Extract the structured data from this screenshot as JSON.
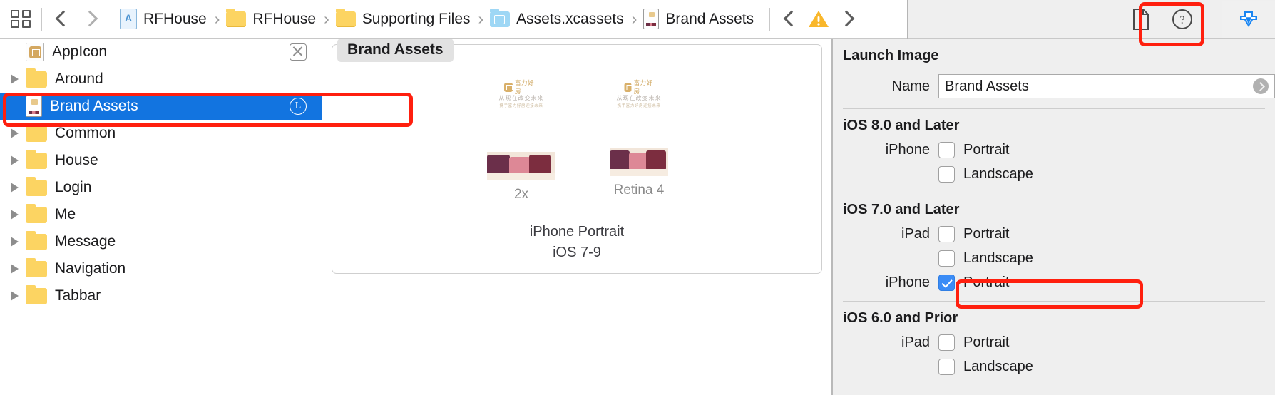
{
  "toolbar": {
    "grid_icon": "grid-icon",
    "back_label": "back",
    "forward_label": "forward",
    "breadcrumb": [
      {
        "label": "RFHouse",
        "icon": "app-project-icon"
      },
      {
        "label": "RFHouse",
        "icon": "folder-icon"
      },
      {
        "label": "Supporting Files",
        "icon": "folder-icon"
      },
      {
        "label": "Assets.xcassets",
        "icon": "xcassets-icon"
      },
      {
        "label": "Brand Assets",
        "icon": "launch-image-icon"
      }
    ],
    "separator": "›",
    "issue_nav_back": "‹",
    "issue_nav_forward": "›",
    "warning_icon": "warning-triangle-icon",
    "document_icon": "file-inspector-icon",
    "help_icon": "quick-help-icon",
    "inspector_toggle_icon": "hide-inspector-icon"
  },
  "sidebar": {
    "items": [
      {
        "label": "AppIcon",
        "icon": "appicon-asset-icon",
        "disclosure": "none",
        "badge": "unassigned-x-badge",
        "selected": false
      },
      {
        "label": "Around",
        "icon": "folder-icon",
        "disclosure": "closed",
        "badge": "",
        "selected": false
      },
      {
        "label": "Brand Assets",
        "icon": "launch-image-icon",
        "disclosure": "none",
        "badge": "L",
        "selected": true
      },
      {
        "label": "Common",
        "icon": "folder-icon",
        "disclosure": "closed",
        "badge": "",
        "selected": false
      },
      {
        "label": "House",
        "icon": "folder-icon",
        "disclosure": "closed",
        "badge": "",
        "selected": false
      },
      {
        "label": "Login",
        "icon": "folder-icon",
        "disclosure": "closed",
        "badge": "",
        "selected": false
      },
      {
        "label": "Me",
        "icon": "folder-icon",
        "disclosure": "closed",
        "badge": "",
        "selected": false
      },
      {
        "label": "Message",
        "icon": "folder-icon",
        "disclosure": "closed",
        "badge": "",
        "selected": false
      },
      {
        "label": "Navigation",
        "icon": "folder-icon",
        "disclosure": "closed",
        "badge": "",
        "selected": false
      },
      {
        "label": "Tabbar",
        "icon": "folder-icon",
        "disclosure": "closed",
        "badge": "",
        "selected": false
      }
    ]
  },
  "editor": {
    "card_title": "Brand Assets",
    "slots": [
      {
        "label": "2x",
        "logo_text": "富力好房",
        "headline": "从现在改变未来",
        "subline": "携手富力好房迎接未来"
      },
      {
        "label": "Retina 4",
        "logo_text": "富力好房",
        "headline": "从现在改变未来",
        "subline": "携手富力好房迎接未来"
      }
    ],
    "caption_line1": "iPhone Portrait",
    "caption_line2": "iOS 7-9"
  },
  "inspector": {
    "title": "Launch Image",
    "name_label": "Name",
    "name_value": "Brand Assets",
    "groups": [
      {
        "title": "iOS 8.0 and Later",
        "rows": [
          {
            "device": "iPhone",
            "orientation": "Portrait",
            "checked": false
          },
          {
            "device": "",
            "orientation": "Landscape",
            "checked": false
          }
        ]
      },
      {
        "title": "iOS 7.0 and Later",
        "rows": [
          {
            "device": "iPad",
            "orientation": "Portrait",
            "checked": false
          },
          {
            "device": "",
            "orientation": "Landscape",
            "checked": false
          },
          {
            "device": "iPhone",
            "orientation": "Portrait",
            "checked": true
          }
        ]
      },
      {
        "title": "iOS 6.0 and Prior",
        "rows": [
          {
            "device": "iPad",
            "orientation": "Portrait",
            "checked": false
          },
          {
            "device": "",
            "orientation": "Landscape",
            "checked": false
          }
        ]
      }
    ]
  },
  "annotations": {
    "color": "#ff1f0e",
    "boxes": [
      "sidebar-brand-assets-row",
      "inspector-toggle-button",
      "iphone-portrait-checkbox-row"
    ]
  }
}
